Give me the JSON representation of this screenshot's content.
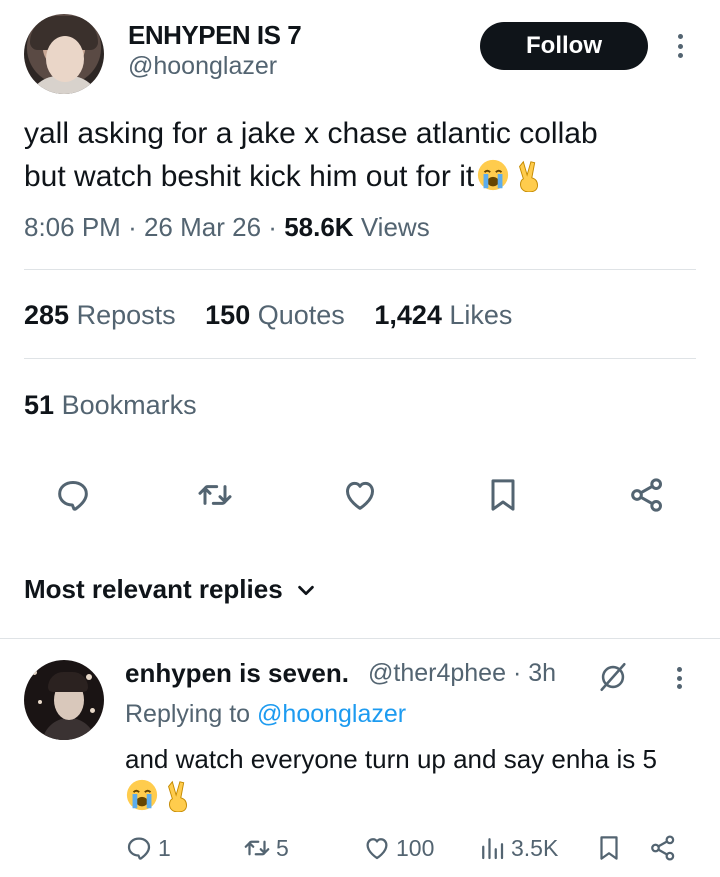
{
  "tweet": {
    "author_name": "ENHYPEN IS 7",
    "author_handle": "@hoonglazer",
    "follow_label": "Follow",
    "text_line1": "yall asking for a jake x chase atlantic collab",
    "text_line2": "but watch beshit kick him out for it",
    "time": "8:06 PM",
    "date": "26 Mar 26",
    "views_count": "58.6K",
    "views_label": "Views",
    "sep": "·"
  },
  "stats": {
    "reposts_count": "285",
    "reposts_label": "Reposts",
    "quotes_count": "150",
    "quotes_label": "Quotes",
    "likes_count": "1,424",
    "likes_label": "Likes",
    "bookmarks_count": "51",
    "bookmarks_label": "Bookmarks"
  },
  "actions": [
    "reply-icon",
    "repost-icon",
    "like-icon",
    "bookmark-icon",
    "share-icon"
  ],
  "replies_header": "Most relevant replies",
  "reply": {
    "author_name": "enhypen is seven.",
    "author_handle": "@ther4phee",
    "time": "3h",
    "replying_prefix": "Replying to",
    "replying_handle": "@hoonglazer",
    "text": "and watch everyone turn up and say enha is 5",
    "replies": "1",
    "reposts": "5",
    "likes": "100",
    "views": "3.5K"
  },
  "colors": {
    "text": "#0f1419",
    "muted": "#536471",
    "link": "#1d9bf0",
    "divider": "#dfe3e6"
  }
}
